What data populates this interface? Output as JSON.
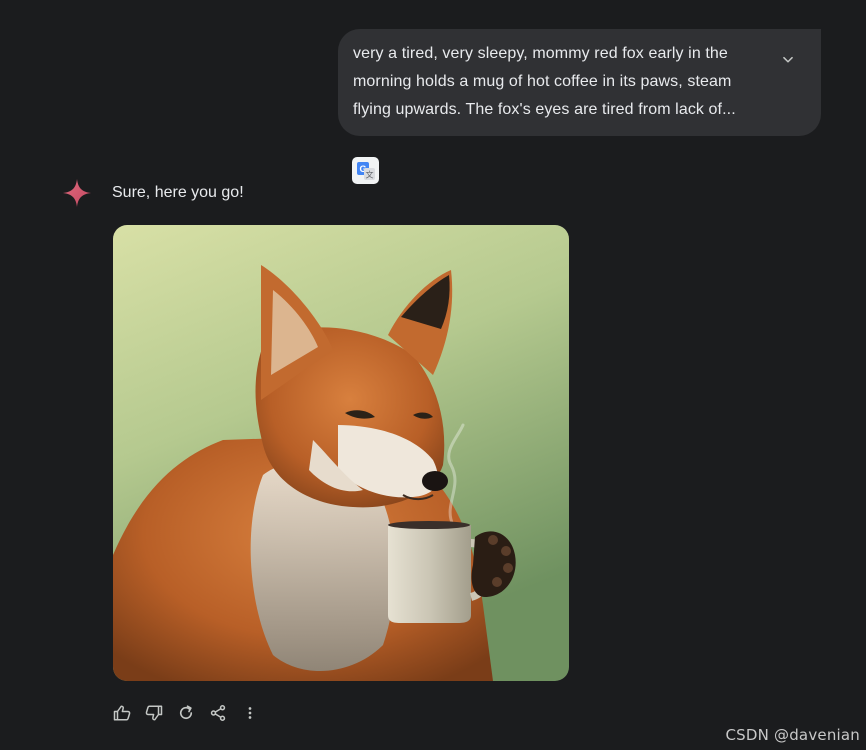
{
  "prompt": {
    "lines": [
      "very a tired, very sleepy, mommy red fox early in the",
      "morning holds a mug of hot coffee in its paws, steam",
      "flying upwards. The fox's eyes are tired from lack of..."
    ],
    "expand_icon": "chevron-down-icon"
  },
  "translate": {
    "icon": "google-translate-icon"
  },
  "response": {
    "avatar_icon": "gemini-sparkle-icon",
    "text": "Sure, here you go!",
    "image_subject": "red fox holding coffee mug"
  },
  "actions": [
    {
      "icon": "thumbs-up-icon"
    },
    {
      "icon": "thumbs-down-icon"
    },
    {
      "icon": "regenerate-icon"
    },
    {
      "icon": "share-icon"
    },
    {
      "icon": "more-vert-icon"
    }
  ],
  "watermark": "CSDN @davenian",
  "colors": {
    "background": "#1b1c1e",
    "bubble": "#303134",
    "text": "#e8eaed",
    "sparkle": "#d65a6e"
  }
}
